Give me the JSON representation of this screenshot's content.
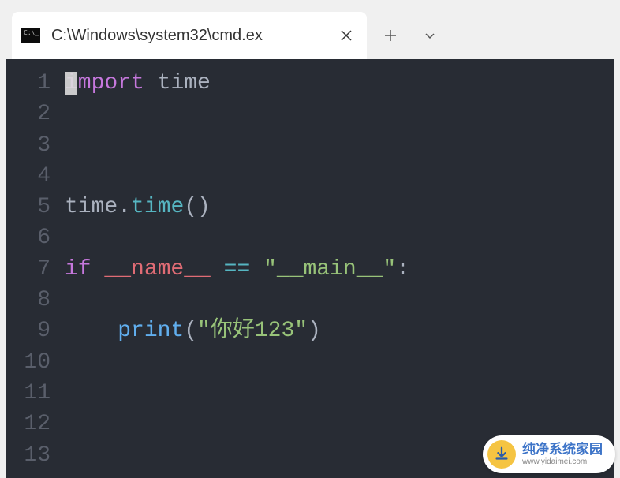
{
  "tab": {
    "title": "C:\\Windows\\system32\\cmd.ex"
  },
  "gutter": {
    "lines": [
      "1",
      "2",
      "3",
      "4",
      "5",
      "6",
      "7",
      "8",
      "9",
      "10",
      "11",
      "12",
      "13"
    ]
  },
  "code": {
    "l1": {
      "import": "import",
      "space": " ",
      "mod": "time"
    },
    "l5": {
      "obj": "time",
      "dot": ".",
      "fn": "time",
      "call": "()"
    },
    "l7": {
      "if": "if",
      "sp1": " ",
      "name": "__name__",
      "sp2": " ",
      "eq": "==",
      "sp3": " ",
      "q1": "\"",
      "main": "__main__",
      "q2": "\"",
      "colon": ":"
    },
    "l9": {
      "indent": "    ",
      "print": "print",
      "lp": "(",
      "q1": "\"",
      "str": "你好123",
      "q2": "\"",
      "rp": ")"
    }
  },
  "watermark": {
    "main": "纯净系统家园",
    "sub": "www.yidaimei.com"
  }
}
